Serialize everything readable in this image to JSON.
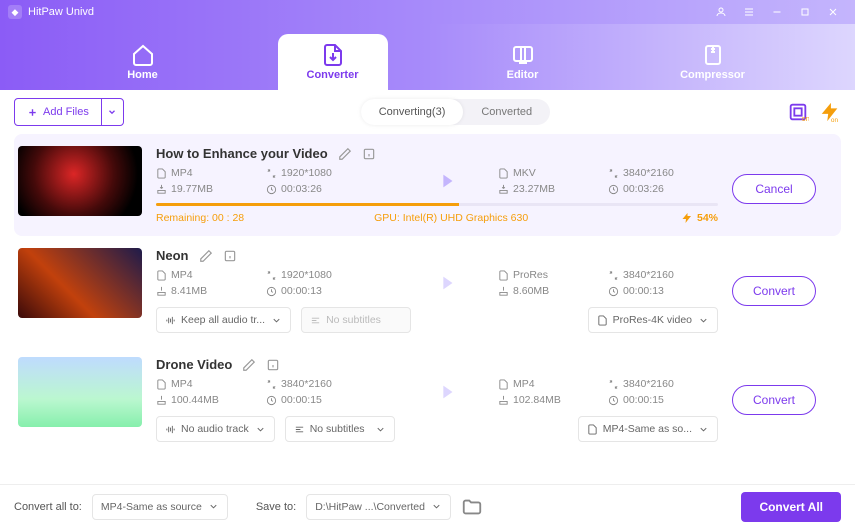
{
  "app": {
    "name": "HitPaw Univd"
  },
  "nav": {
    "home": "Home",
    "converter": "Converter",
    "editor": "Editor",
    "compressor": "Compressor"
  },
  "toolbar": {
    "add_files": "Add Files",
    "converting_tab": "Converting(3)",
    "converted_tab": "Converted"
  },
  "items": [
    {
      "title": "How to Enhance your Video",
      "src": {
        "format": "MP4",
        "resolution": "1920*1080",
        "size": "19.77MB",
        "duration": "00:03:26"
      },
      "dst": {
        "format": "MKV",
        "resolution": "3840*2160",
        "size": "23.27MB",
        "duration": "00:03:26"
      },
      "progress_pct": 54,
      "remaining": "Remaining: 00 : 28",
      "gpu": "GPU: Intel(R) UHD Graphics 630",
      "pct_label": "54%",
      "action": "Cancel"
    },
    {
      "title": "Neon",
      "src": {
        "format": "MP4",
        "resolution": "1920*1080",
        "size": "8.41MB",
        "duration": "00:00:13"
      },
      "dst": {
        "format": "ProRes",
        "resolution": "3840*2160",
        "size": "8.60MB",
        "duration": "00:00:13"
      },
      "audio_dd": "Keep all audio tr...",
      "subtitle_dd": "No subtitles",
      "output_dd": "ProRes-4K video",
      "action": "Convert"
    },
    {
      "title": "Drone Video",
      "src": {
        "format": "MP4",
        "resolution": "3840*2160",
        "size": "100.44MB",
        "duration": "00:00:15"
      },
      "dst": {
        "format": "MP4",
        "resolution": "3840*2160",
        "size": "102.84MB",
        "duration": "00:00:15"
      },
      "audio_dd": "No audio track",
      "subtitle_dd": "No subtitles",
      "output_dd": "MP4-Same as so...",
      "action": "Convert"
    }
  ],
  "footer": {
    "convert_all_to": "Convert all to:",
    "convert_all_value": "MP4-Same as source",
    "save_to": "Save to:",
    "save_to_value": "D:\\HitPaw ...\\Converted",
    "convert_all_btn": "Convert All"
  }
}
